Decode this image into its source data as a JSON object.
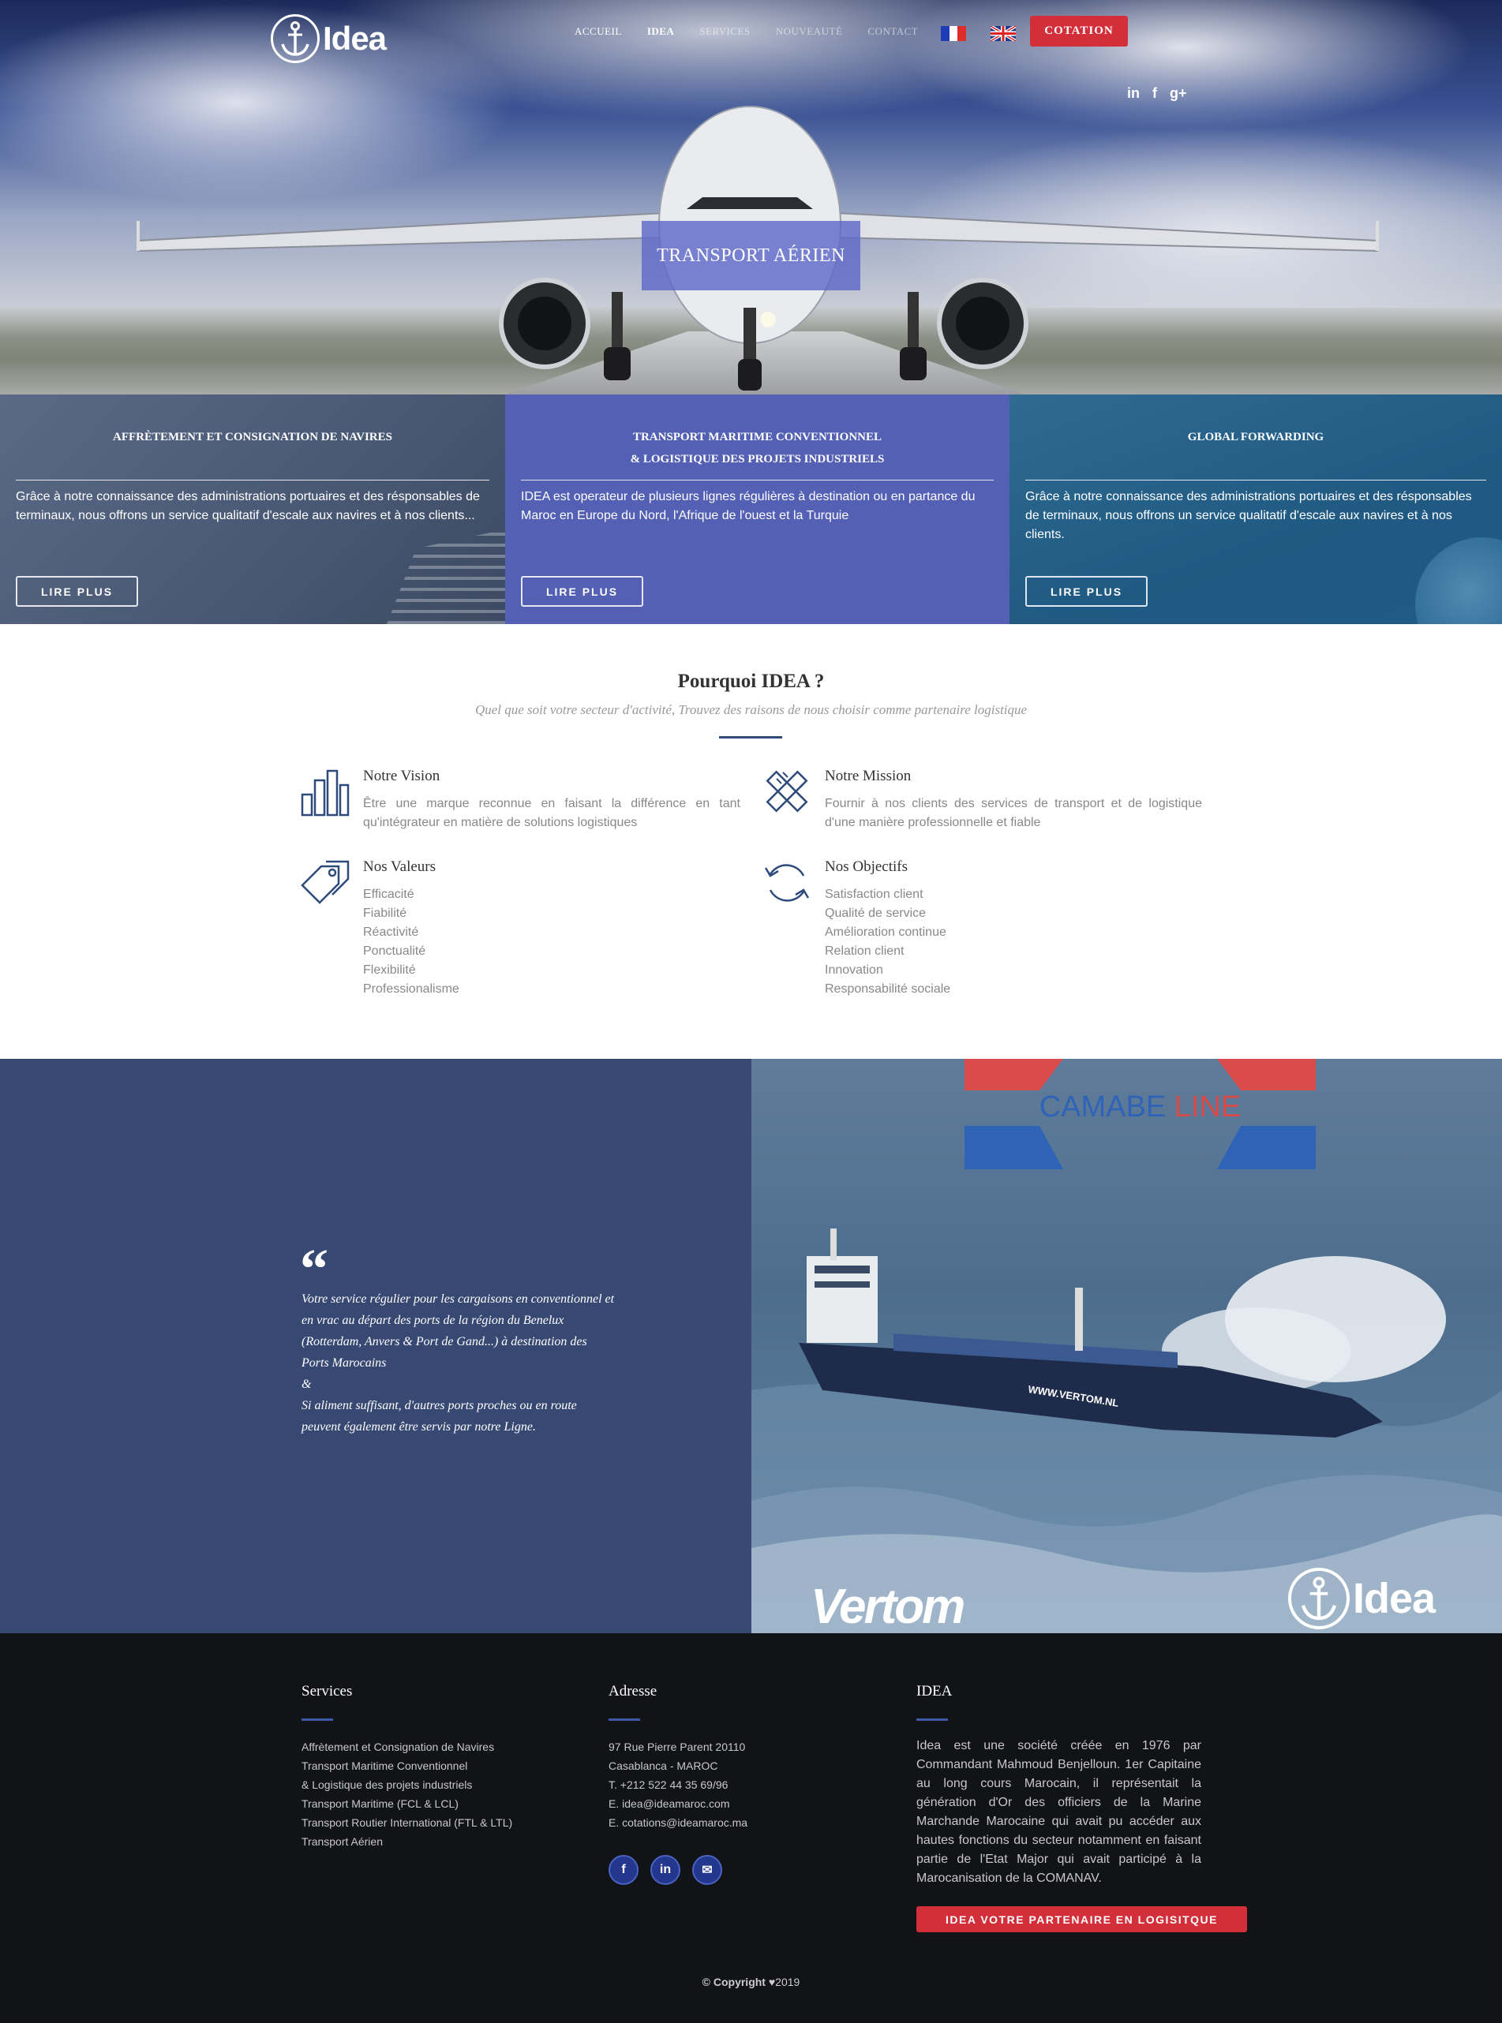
{
  "brand": {
    "name": "Idea"
  },
  "nav": {
    "items": [
      {
        "label": "ACCUEIL",
        "state": "normal"
      },
      {
        "label": "IDEA",
        "state": "active"
      },
      {
        "label": "SERVICES",
        "state": "faded"
      },
      {
        "label": "NOUVEAUTÉ",
        "state": "faded"
      },
      {
        "label": "CONTACT",
        "state": "faded"
      }
    ],
    "languages": [
      {
        "icon": "flag-fr-icon"
      },
      {
        "icon": "flag-uk-icon"
      }
    ],
    "cta_label": "COTATION",
    "social": [
      "in",
      "f",
      "g+"
    ]
  },
  "hero": {
    "caption": "TRANSPORT AÉRIEN"
  },
  "services": [
    {
      "title": "AFFRÈTEMENT ET CONSIGNATION DE NAVIRES",
      "text": "Grâce à notre connaissance des administrations portuaires et des résponsables de terminaux, nous offrons un service qualitatif d'escale aux navires et à nos clients...",
      "button": "LIRE PLUS"
    },
    {
      "title_line1": "TRANSPORT MARITIME CONVENTIONNEL",
      "title_line2": "& LOGISTIQUE DES PROJETS INDUSTRIELS",
      "text": "IDEA est operateur de plusieurs lignes régulières à destination ou en partance du Maroc en Europe du Nord, l'Afrique de l'ouest et la Turquie",
      "button": "LIRE PLUS"
    },
    {
      "title": "GLOBAL FORWARDING",
      "text": "Grâce à notre connaissance des administrations portuaires et des résponsables de terminaux, nous offrons un service qualitatif d'escale aux navires et à nos clients.",
      "button": "LIRE PLUS"
    }
  ],
  "why": {
    "title": "Pourquoi IDEA ?",
    "subtitle": "Quel que soit votre secteur d'activité, Trouvez des raisons de nous choisir comme partenaire logistique",
    "vision": {
      "title": "Notre Vision",
      "text": "Être une marque reconnue en faisant la différence en tant qu'intégrateur en matière de solutions logistiques"
    },
    "mission": {
      "title": "Notre Mission",
      "text": "Fournir à nos clients des services de transport et de logistique d'une manière professionnelle et fiable"
    },
    "values": {
      "title": "Nos Valeurs",
      "items": [
        "Efficacité",
        "Fiabilité",
        "Réactivité",
        "Ponctualité",
        "Flexibilité",
        "Professionalisme"
      ]
    },
    "objectives": {
      "title": "Nos Objectifs",
      "items": [
        "Satisfaction client",
        "Qualité de service",
        "Amélioration continue",
        "Relation client",
        "Innovation",
        "Responsabilité sociale"
      ]
    }
  },
  "quote": {
    "mark": "“",
    "lines": [
      "Votre service régulier pour les cargaisons en conventionnel et",
      "en vrac au départ des ports de la région du Benelux",
      "(Rotterdam, Anvers & Port de Gand...) à destination des",
      "Ports Marocains",
      "&",
      "Si aliment suffisant, d'autres ports proches ou en route",
      "peuvent également être servis par notre Ligne."
    ]
  },
  "ship_image": {
    "camabe_part1": "CAMABE",
    "camabe_part2": "LINE",
    "hull_text": "WWW.VERTOM.NL",
    "vertom_logo": "Vertom",
    "idea_logo": "Idea",
    "colors": {
      "camabe_red": "#d94a4a",
      "camabe_blue": "#2f63b8"
    }
  },
  "footer": {
    "services": {
      "title": "Services",
      "items": [
        "Affrètement et Consignation de Navires",
        "Transport Maritime Conventionnel",
        "& Logistique des projets industriels",
        "Transport Maritime (FCL & LCL)",
        "Transport Routier International (FTL & LTL)",
        "Transport Aérien"
      ]
    },
    "address": {
      "title": "Adresse",
      "lines": [
        "97 Rue Pierre Parent 20110",
        "Casablanca - MAROC",
        "T. +212 522 44 35 69/96",
        "E. idea@ideamaroc.com",
        "E. cotations@ideamaroc.ma"
      ],
      "social": [
        "f",
        "in",
        "✉"
      ]
    },
    "about": {
      "title": "IDEA",
      "text": "Idea est une société créée en 1976 par Commandant Mahmoud Benjelloun. 1er Capitaine au long cours Marocain, il représentait la génération d'Or des officiers de la Marine Marchande Marocaine qui avait pu accéder aux hautes fonctions du secteur notamment en faisant partie de l'Etat Major qui avait participé à la Marocanisation de la COMANAV.",
      "button": "IDEA VOTRE PARTENAIRE EN LOGISITQUE"
    },
    "copyright_prefix": "© Copyright ",
    "copyright_year": "♥2019"
  },
  "colors": {
    "accent_red": "#d32f3a",
    "navy": "#374872",
    "service_purple": "#5360b3",
    "service_teal": "#205a83",
    "footer_bg": "#121317"
  }
}
